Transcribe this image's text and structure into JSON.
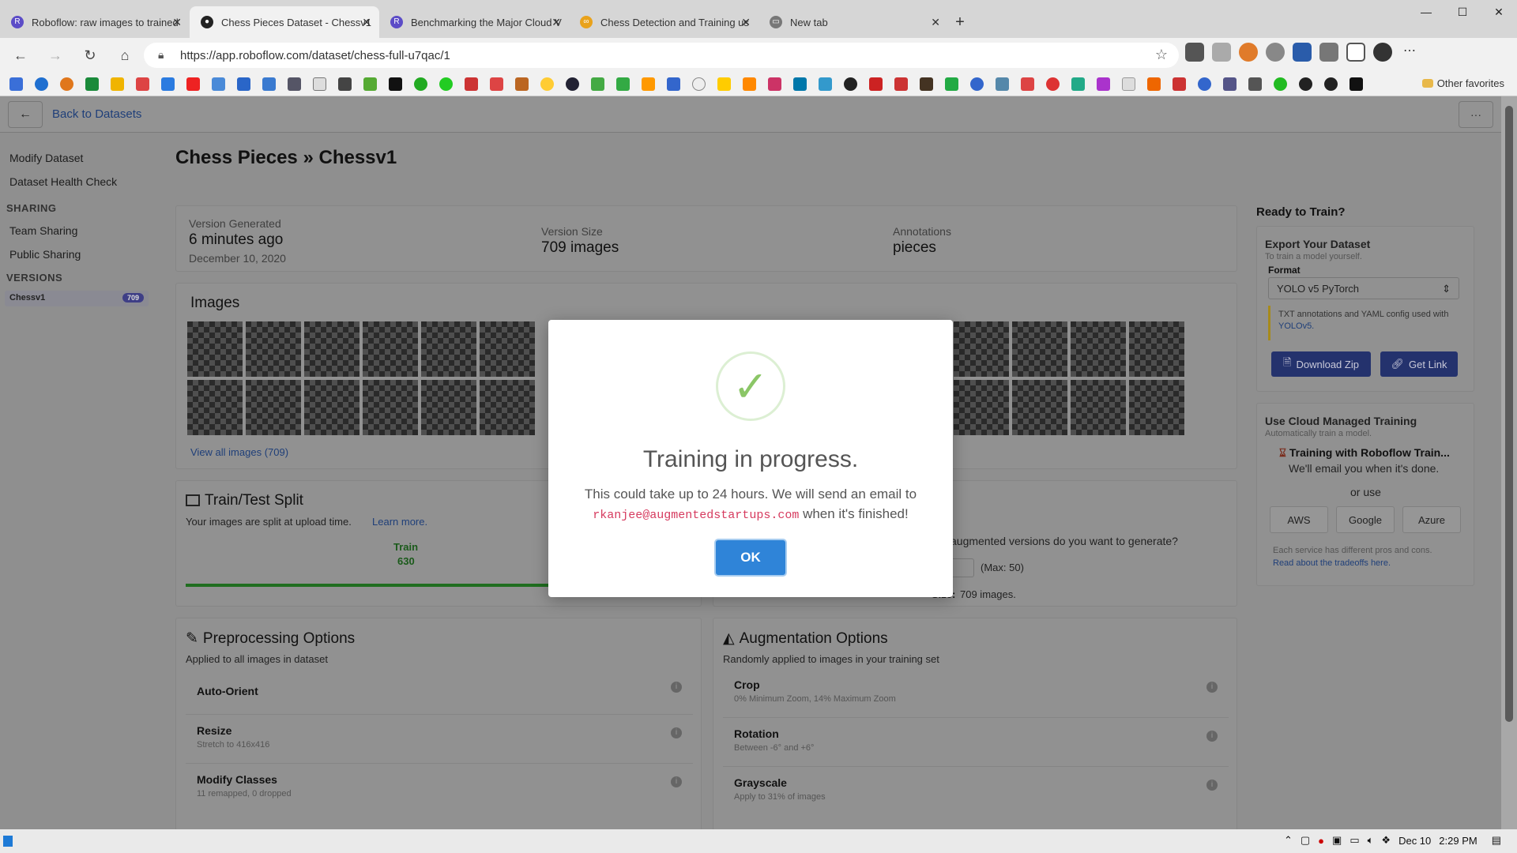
{
  "browser": {
    "tabs": [
      {
        "title": "Roboflow: raw images to trained",
        "active": false
      },
      {
        "title": "Chess Pieces Dataset - Chessv1",
        "active": true
      },
      {
        "title": "Benchmarking the Major Cloud V",
        "active": false
      },
      {
        "title": "Chess Detection and Training us",
        "active": false
      },
      {
        "title": "New tab",
        "active": false
      }
    ],
    "url": "https://app.roboflow.com/dataset/chess-full-u7qac/1",
    "other_favorites": "Other favorites"
  },
  "nav": {
    "back_label": "Back to Datasets"
  },
  "sidebar": {
    "items": [
      "Modify Dataset",
      "Dataset Health Check"
    ],
    "sharing_heading": "SHARING",
    "sharing_items": [
      "Team Sharing",
      "Public Sharing"
    ],
    "versions_heading": "VERSIONS",
    "version_name": "Chessv1",
    "version_count": "709"
  },
  "page": {
    "title": "Chess Pieces",
    "title_sep": "»",
    "subtitle": "Chessv1"
  },
  "summary": {
    "generated_label": "Version Generated",
    "generated_value": "6 minutes ago",
    "generated_date": "December 10, 2020",
    "size_label": "Version Size",
    "size_value": "709 images",
    "annotations_label": "Annotations",
    "annotations_value": "pieces"
  },
  "images": {
    "heading": "Images",
    "view_all": "View all images (709)"
  },
  "split": {
    "heading": "Train/Test Split",
    "desc": "Your images are split at upload time.",
    "learn_more": "Learn more.",
    "train_label": "Train",
    "train_value": "630",
    "train_fraction": 0.888
  },
  "augment": {
    "question": "augmented versions do you want to generate?",
    "max": "(Max: 50)",
    "size_label": "Size:",
    "size_value": "709 images."
  },
  "preprocessing": {
    "heading": "Preprocessing Options",
    "desc": "Applied to all images in dataset",
    "options": [
      {
        "name": "Auto-Orient",
        "sub": ""
      },
      {
        "name": "Resize",
        "sub": "Stretch to 416x416"
      },
      {
        "name": "Modify Classes",
        "sub": "11 remapped, 0 dropped"
      }
    ]
  },
  "augmentation": {
    "heading": "Augmentation Options",
    "desc": "Randomly applied to images in your training set",
    "options": [
      {
        "name": "Crop",
        "sub": "0% Minimum Zoom, 14% Maximum Zoom"
      },
      {
        "name": "Rotation",
        "sub": "Between -6° and +6°"
      },
      {
        "name": "Grayscale",
        "sub": "Apply to 31% of images"
      }
    ]
  },
  "train_panel": {
    "heading": "Ready to Train?",
    "export_title": "Export Your Dataset",
    "export_sub": "To train a model yourself.",
    "format_label": "Format",
    "format_value": "YOLO v5 PyTorch",
    "format_note": "TXT annotations and YAML config used with",
    "format_note_link": "YOLOv5.",
    "download_btn": "Download Zip",
    "link_btn": "Get Link",
    "cloud_title": "Use Cloud Managed Training",
    "cloud_sub": "Automatically train a model.",
    "training_status": "Training with Roboflow Train...",
    "email_note": "We'll email you when it's done.",
    "or_use": "or use",
    "providers": [
      "AWS",
      "Google",
      "Azure"
    ],
    "pros_note": "Each service has different pros and cons.",
    "tradeoffs_link": "Read about the tradeoffs here."
  },
  "modal": {
    "title": "Training in progress.",
    "text_before": "This could take up to 24 hours. We will send an email to",
    "email": "rkanjee@augmentedstartups.com",
    "text_after": "when it's finished!",
    "ok": "OK"
  },
  "taskbar": {
    "date": "Dec 10",
    "time": "2:29 PM"
  },
  "colors": {
    "accent": "#2f84d8",
    "success": "#8bc667",
    "email": "#d63a5e",
    "train_bar": "#1f7a1f"
  }
}
